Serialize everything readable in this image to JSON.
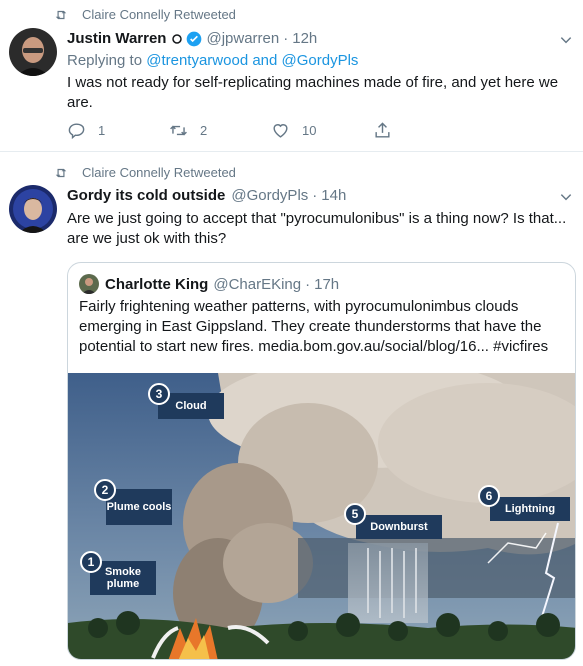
{
  "tweets": [
    {
      "retweeted_by": "Claire Connelly Retweeted",
      "name": "Justin Warren",
      "handle": "@jpwarren",
      "time": "12h",
      "replying_prefix": "Replying to",
      "replying_users": "@trentyarwood and @GordyPls",
      "text": "I was not ready for self-replicating machines made of fire, and yet here we are.",
      "reply_count": "1",
      "retweet_count": "2",
      "like_count": "10"
    },
    {
      "retweeted_by": "Claire Connelly Retweeted",
      "name": "Gordy its cold outside",
      "handle": "@GordyPls",
      "time": "14h",
      "text": "Are we just going to accept that \"pyrocumulonibus\" is a thing now? Is that... are we just ok with this?",
      "quote": {
        "name": "Charlotte King",
        "handle": "@CharEKing",
        "time": "17h",
        "text": "Fairly frightening weather patterns, with pyrocumulonimbus clouds emerging in East Gippsland. They create thunderstorms that have the potential to start new fires. media.bom.gov.au/social/blog/16... #vicfires",
        "image_labels": {
          "n1": "1",
          "l1": "Smoke plume",
          "n2": "2",
          "l2": "Plume cools",
          "n3": "3",
          "l3": "Cloud",
          "n5": "5",
          "l5": "Downburst",
          "n6": "6",
          "l6": "Lightning"
        }
      }
    }
  ],
  "colors": {
    "link": "#1b95e0",
    "muted": "#657786",
    "verified": "#1da1f2",
    "label_bg": "#1f3a5c"
  }
}
